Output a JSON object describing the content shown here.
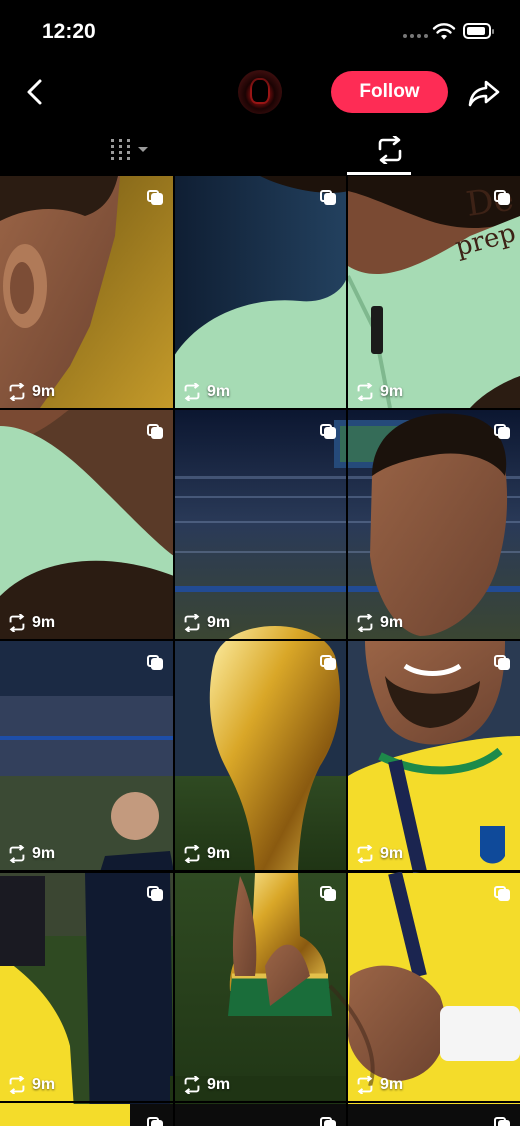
{
  "status_bar": {
    "time": "12:20"
  },
  "header": {
    "follow_label": "Follow"
  },
  "tabs": [
    {
      "name": "posts-grid",
      "icon": "grid-columns-icon"
    },
    {
      "name": "reposts",
      "icon": "repost-icon",
      "selected": true
    }
  ],
  "grid": {
    "items": [
      {
        "time": "9m"
      },
      {
        "time": "9m"
      },
      {
        "time": "9m"
      },
      {
        "time": "9m"
      },
      {
        "time": "9m"
      },
      {
        "time": "9m"
      },
      {
        "time": "9m"
      },
      {
        "time": "9m"
      },
      {
        "time": "9m"
      },
      {
        "time": "9m"
      },
      {
        "time": "9m"
      },
      {
        "time": "9m"
      }
    ]
  },
  "colors": {
    "accent": "#fe2c55",
    "background": "#000000",
    "jersey_green": "#a6dbb4",
    "jersey_yellow": "#f4dc2a"
  }
}
